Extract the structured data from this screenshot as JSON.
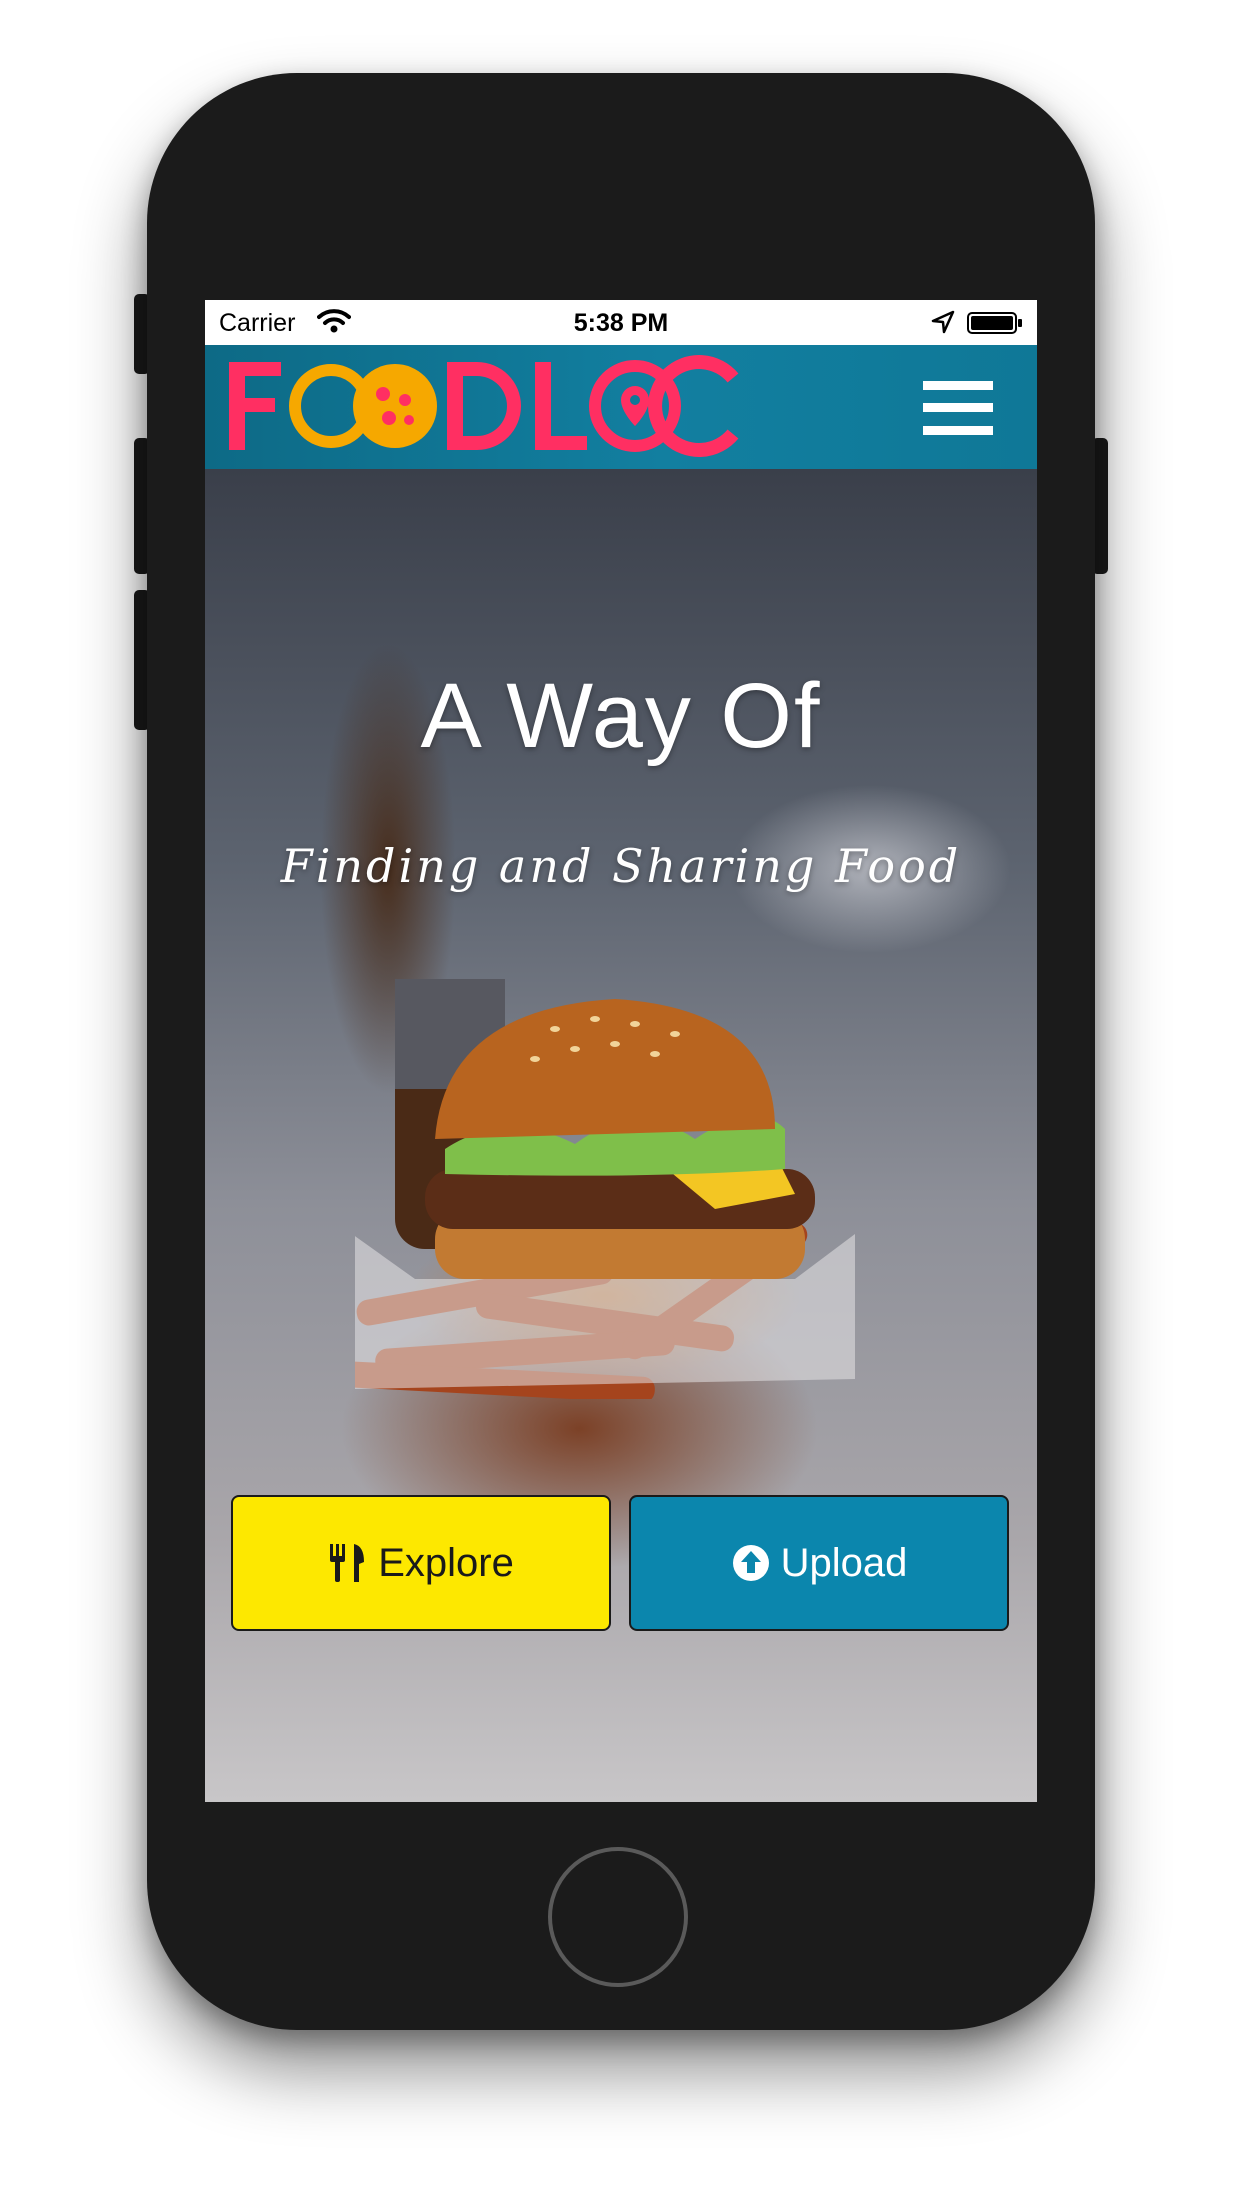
{
  "status_bar": {
    "carrier": "Carrier",
    "time": "5:38 PM"
  },
  "navbar": {
    "logo_text": "FOODLOC",
    "brand_color": "#ff2f62",
    "background_color": "#0f7897",
    "menu_icon": "hamburger-menu-icon"
  },
  "hero": {
    "title": "A Way Of",
    "subtitle": "Finding and Sharing Food",
    "background_image": "burger-and-fries-photo"
  },
  "actions": {
    "explore": {
      "label": "Explore",
      "icon": "fork-knife-icon",
      "color": "#fde800"
    },
    "upload": {
      "label": "Upload",
      "icon": "upload-circle-icon",
      "color": "#0b86ad"
    }
  }
}
